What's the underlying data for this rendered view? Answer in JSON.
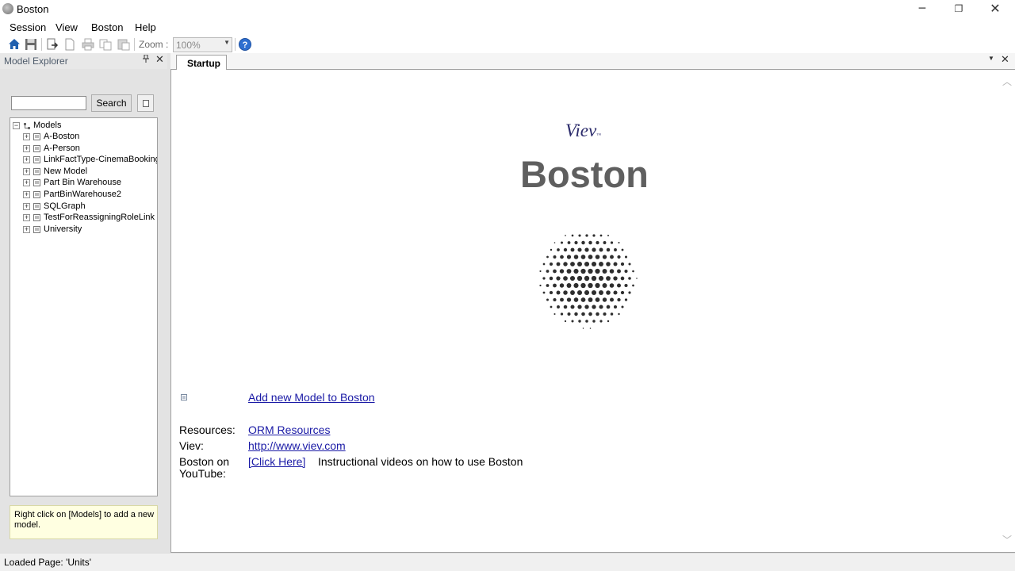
{
  "window": {
    "title": "Boston",
    "minimize_glyph": "─",
    "maximize_glyph": "❐",
    "close_glyph": "✕"
  },
  "menu": {
    "items": [
      "Session",
      "View",
      "Boston",
      "Help"
    ]
  },
  "toolbar": {
    "icons": [
      "home-icon",
      "save-icon",
      "export-icon",
      "new-page-icon",
      "print-icon",
      "copy-icon",
      "paste-icon"
    ],
    "zoom_label": "Zoom :",
    "zoom_value": "100%",
    "zoom_arrow": "▼",
    "help_label": "?"
  },
  "left_panel": {
    "title": "Model Explorer",
    "pin_glyph": "🖈",
    "close_glyph": "✕",
    "search_placeholder": "",
    "search_value": "",
    "search_button": "Search",
    "tree": {
      "root": "Models",
      "root_expander": "−",
      "items": [
        "A-Boston",
        "A-Person",
        "LinkFactType-CinemaBookings",
        "New Model",
        "Part Bin Warehouse",
        "PartBinWarehouse2",
        "SQLGraph",
        "TestForReassigningRoleLink",
        "University"
      ],
      "item_expander": "+"
    },
    "hint": "Right click on [Models] to add a new model."
  },
  "document": {
    "tab_label": "Startup",
    "tab_dropdown_glyph": "▼",
    "tab_close_glyph": "✕",
    "scroll_up_glyph": "︿",
    "scroll_down_glyph": "﹀",
    "viev_logo": "Viev",
    "viev_tm": "™",
    "heading": "Boston",
    "add_model_link": "Add new Model to Boston",
    "resources_label": "Resources:",
    "resources_link": "ORM Resources",
    "viev_label": "Viev:",
    "viev_link": "http://www.viev.com",
    "youtube_label_line1": "Boston on",
    "youtube_label_line2": "YouTube:",
    "youtube_link": "[Click Here]",
    "youtube_description": "Instructional videos on how to use Boston"
  },
  "status": {
    "text": "Loaded Page: 'Units'"
  },
  "colors": {
    "accent_blue": "#1a1aa6",
    "heading_gray": "#5f5f5f",
    "hint_background": "#ffffe1",
    "panel_background": "#e3e3e3"
  }
}
